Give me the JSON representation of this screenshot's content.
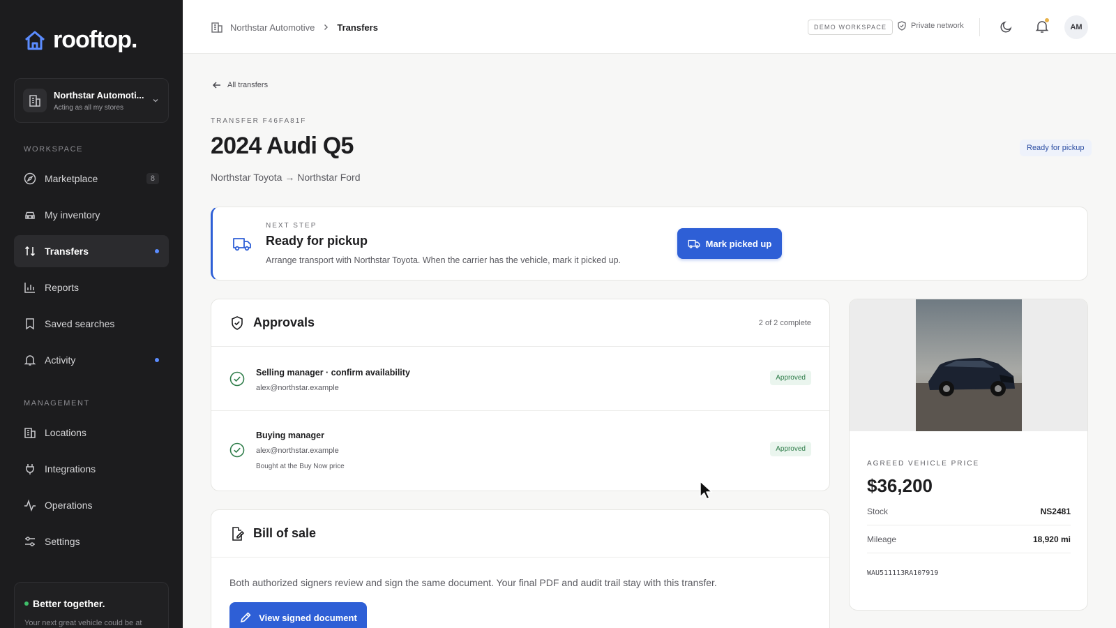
{
  "app": {
    "name": "rooftop."
  },
  "sidebar": {
    "org": {
      "name": "Northstar Automoti...",
      "subtitle": "Acting as all my stores"
    },
    "workspace_label": "WORKSPACE",
    "management_label": "MANAGEMENT",
    "items": [
      {
        "label": "Marketplace",
        "icon": "compass-icon",
        "count": "8"
      },
      {
        "label": "My inventory",
        "icon": "car-icon"
      },
      {
        "label": "Transfers",
        "icon": "arrows-updown-icon",
        "active": true,
        "dot": true
      },
      {
        "label": "Reports",
        "icon": "bar-chart-icon"
      },
      {
        "label": "Saved searches",
        "icon": "bookmark-icon"
      },
      {
        "label": "Activity",
        "icon": "bell-icon",
        "dot": true
      },
      {
        "label": "Locations",
        "icon": "building-icon"
      },
      {
        "label": "Integrations",
        "icon": "plug-icon"
      },
      {
        "label": "Operations",
        "icon": "activity-icon"
      },
      {
        "label": "Settings",
        "icon": "sliders-icon"
      }
    ],
    "promo": {
      "title": "Better together.",
      "subtitle": "Your next great vehicle could be at"
    }
  },
  "topbar": {
    "breadcrumb": [
      "Northstar Automotive",
      "Transfers"
    ],
    "demo_badge": "DEMO WORKSPACE",
    "private_network": "Private network",
    "avatar_initials": "AM"
  },
  "transfer": {
    "back_label": "All transfers",
    "id_label": "TRANSFER F46FA81F",
    "title": "2024 Audi Q5",
    "route": "Northstar Toyota → Northstar Ford",
    "status": "Ready for pickup"
  },
  "next_step": {
    "label": "NEXT STEP",
    "title": "Ready for pickup",
    "description": "Arrange transport with Northstar Toyota. When the carrier has the vehicle, mark it picked up.",
    "button": "Mark picked up"
  },
  "approvals": {
    "title": "Approvals",
    "progress": "2 of 2 complete",
    "rows": [
      {
        "role": "Selling manager · confirm availability",
        "email": "alex@northstar.example",
        "note": "",
        "status": "Approved"
      },
      {
        "role": "Buying manager",
        "email": "alex@northstar.example",
        "note": "Bought at the Buy Now price",
        "status": "Approved"
      }
    ]
  },
  "bill_of_sale": {
    "title": "Bill of sale",
    "description": "Both authorized signers review and sign the same document. Your final PDF and audit trail stay with this transfer.",
    "button": "View signed document"
  },
  "vehicle": {
    "price_label": "AGREED VEHICLE PRICE",
    "price": "$36,200",
    "specs": [
      {
        "key": "Stock",
        "value": "NS2481"
      },
      {
        "key": "Mileage",
        "value": "18,920 mi"
      }
    ],
    "vin": "WAU511113RA107919"
  },
  "colors": {
    "accent": "#2e5fd6",
    "sidebar_bg": "#1c1c1e",
    "approved": "#2f7d4a"
  }
}
